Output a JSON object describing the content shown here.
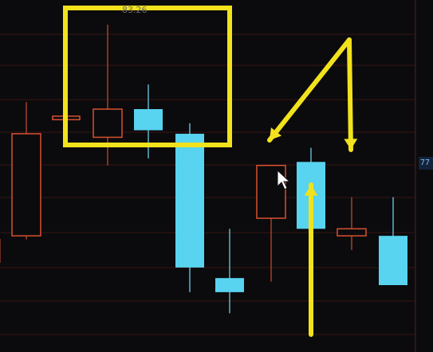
{
  "chart_data": {
    "type": "candlestick",
    "title": "",
    "xlabel": "",
    "ylabel": "",
    "ylim": [
      74,
      84
    ],
    "grid": true,
    "annotations": {
      "high_label": "83.26",
      "last_price_tag": "77"
    },
    "candles": [
      {
        "open": 80.2,
        "high": 81.1,
        "low": 77.2,
        "close": 77.3,
        "color": "up"
      },
      {
        "open": 80.6,
        "high": 80.7,
        "low": 80.5,
        "close": 80.7,
        "color": "up"
      },
      {
        "open": 80.1,
        "high": 83.3,
        "low": 79.3,
        "close": 80.9,
        "color": "up"
      },
      {
        "open": 80.9,
        "high": 81.6,
        "low": 79.5,
        "close": 80.3,
        "color": "down"
      },
      {
        "open": 80.2,
        "high": 80.5,
        "low": 75.7,
        "close": 76.4,
        "color": "down"
      },
      {
        "open": 76.1,
        "high": 77.5,
        "low": 75.1,
        "close": 75.7,
        "color": "down"
      },
      {
        "open": 77.8,
        "high": 78.2,
        "low": 76.0,
        "close": 79.3,
        "color": "up"
      },
      {
        "open": 79.4,
        "high": 79.8,
        "low": 77.8,
        "close": 77.5,
        "color": "down"
      },
      {
        "open": 77.5,
        "high": 78.4,
        "low": 76.9,
        "close": 77.3,
        "color": "up"
      },
      {
        "open": 77.3,
        "high": 78.4,
        "low": 76.2,
        "close": 75.9,
        "color": "down"
      }
    ],
    "overlay": {
      "highlight_box_color": "#f2e21d",
      "arrow_color": "#f2e21d",
      "up_color": "#d9502f",
      "down_color": "#58d3f0",
      "grid_color": "#3a1414"
    }
  }
}
